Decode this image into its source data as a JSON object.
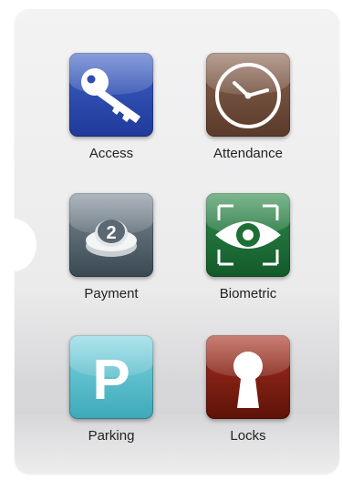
{
  "tiles": {
    "access": {
      "label": "Access",
      "icon": "key-icon",
      "color": "#2f4db0"
    },
    "attendance": {
      "label": "Attendance",
      "icon": "clock-icon",
      "color": "#6f4c3a"
    },
    "payment": {
      "label": "Payment",
      "icon": "coin-icon",
      "coin_value": "2",
      "color": "#55636e"
    },
    "biometric": {
      "label": "Biometric",
      "icon": "eye-icon",
      "color": "#1e6f36"
    },
    "parking": {
      "label": "Parking",
      "icon": "parking-icon",
      "letter": "P",
      "color": "#5ac0cd"
    },
    "locks": {
      "label": "Locks",
      "icon": "keyhole-icon",
      "color": "#7e1f12"
    }
  }
}
